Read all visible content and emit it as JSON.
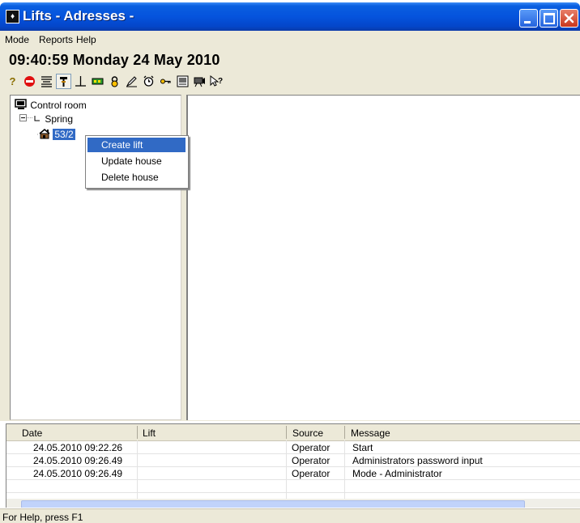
{
  "window": {
    "title": "Lifts - Adresses -"
  },
  "menu": [
    {
      "label": "Mode"
    },
    {
      "label": "Reports"
    },
    {
      "label": "Help"
    }
  ],
  "clock": {
    "text": "09:40:59 Monday 24 May 2010"
  },
  "toolbar": {
    "icons": [
      "help-icon",
      "stop-icon",
      "list-icon",
      "pin-icon",
      "line-icon",
      "display-icon",
      "lock-icon",
      "pencil-icon",
      "alarm-icon",
      "key-icon",
      "screen-icon",
      "camera-icon",
      "help-pointer-icon"
    ]
  },
  "tree": {
    "root": "Control room",
    "group": "Spring",
    "house": "53/2"
  },
  "context_menu": {
    "items": [
      "Create lift",
      "Update house",
      "Delete house"
    ],
    "highlighted": 0
  },
  "log": {
    "columns": [
      "Date",
      "Lift",
      "Source",
      "Message"
    ],
    "rows": [
      {
        "date": "24.05.2010 09:22.26",
        "lift": "",
        "source": "Operator",
        "message": "Start"
      },
      {
        "date": "24.05.2010 09:26.49",
        "lift": "",
        "source": "Operator",
        "message": "Administrators password input"
      },
      {
        "date": "24.05.2010 09:26.49",
        "lift": "",
        "source": "Operator",
        "message": "Mode - Administrator"
      }
    ]
  },
  "statusbar": {
    "text": "For Help, press F1"
  },
  "colors": {
    "titlebar": "#0553dd",
    "selection": "#316ac5",
    "chrome": "#ece9d8"
  }
}
